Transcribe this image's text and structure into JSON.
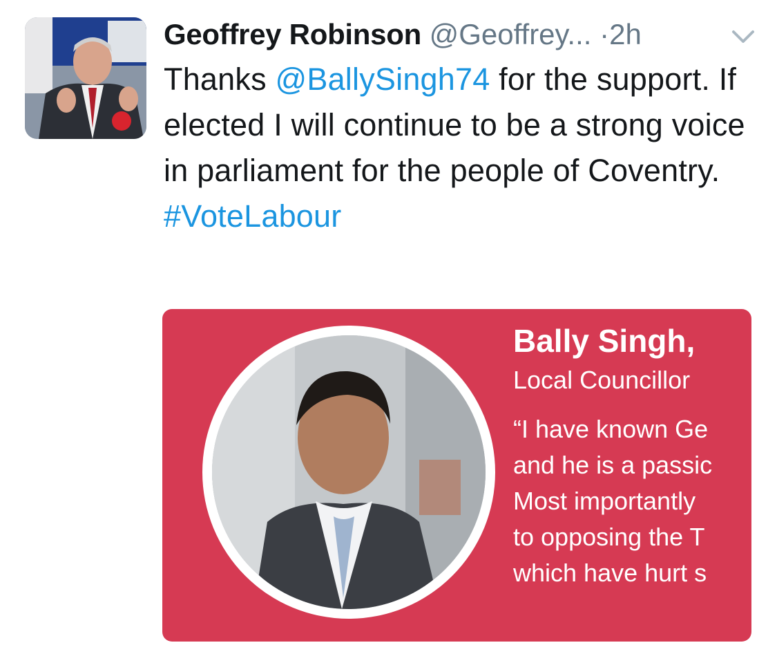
{
  "tweet": {
    "author_name": "Geoffrey Robinson",
    "author_handle": "@Geoffrey...",
    "separator": "·",
    "timestamp": "2h",
    "text_before_mention": "Thanks ",
    "mention": "@BallySingh74",
    "text_after_mention": " for the support. If elected I will continue to be a strong voice in parliament for the people of Coventry.",
    "hashtag": "#VoteLabour"
  },
  "icons": {
    "avatar": "profile-photo",
    "more": "chevron-down-icon"
  },
  "media_card": {
    "name": "Bally Singh,",
    "role": "Local Councillor",
    "quote_lines": [
      "“I have known Ge",
      "and he is a passic",
      "Most importantly",
      "to opposing the T",
      "which have hurt s"
    ]
  },
  "colors": {
    "link": "#1b95e0",
    "card_background": "#d63a53",
    "muted_text": "#657786"
  }
}
